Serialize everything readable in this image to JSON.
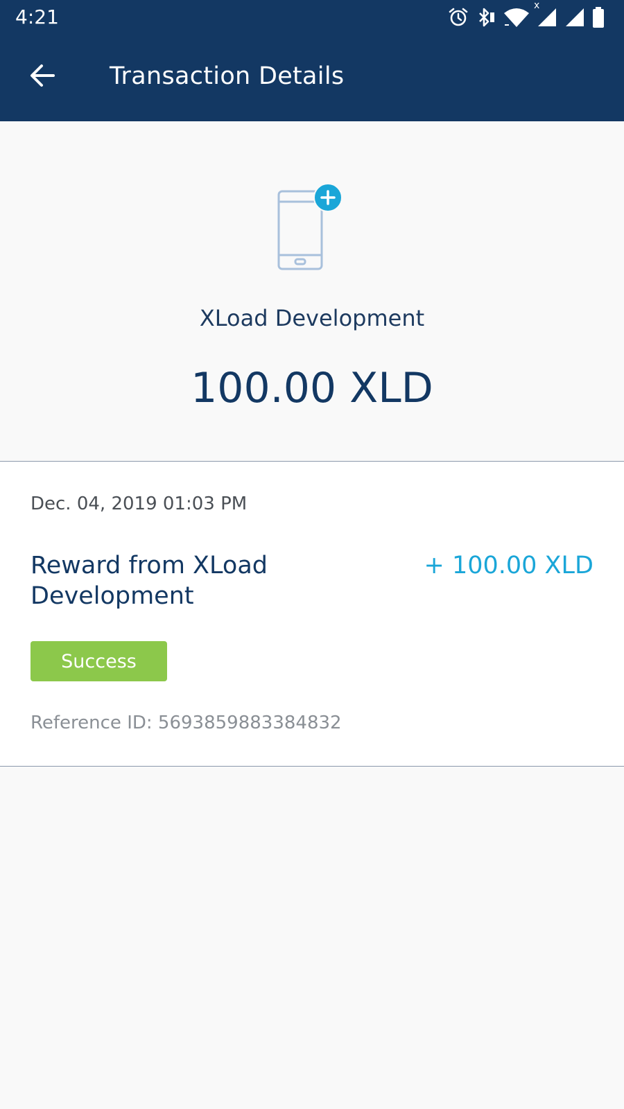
{
  "status_bar": {
    "time": "4:21",
    "icons": [
      "alarm-icon",
      "bluetooth-icon",
      "wifi-icon",
      "signal-icon",
      "signal-icon",
      "battery-icon"
    ],
    "network_badge": "x"
  },
  "header": {
    "back_icon": "arrow-left-icon",
    "title": "Transaction Details",
    "background_color": "#133863"
  },
  "summary": {
    "icon": "mobile-topup-icon",
    "merchant": "XLoad Development",
    "amount": "100.00 XLD"
  },
  "transaction": {
    "date": "Dec. 04, 2019 01:03 PM",
    "description": "Reward from XLoad Development",
    "amount": "+ 100.00 XLD",
    "amount_color": "#1aa6d8",
    "status": "Success",
    "status_color": "#8cc84b",
    "reference": "Reference ID: 5693859883384832"
  }
}
